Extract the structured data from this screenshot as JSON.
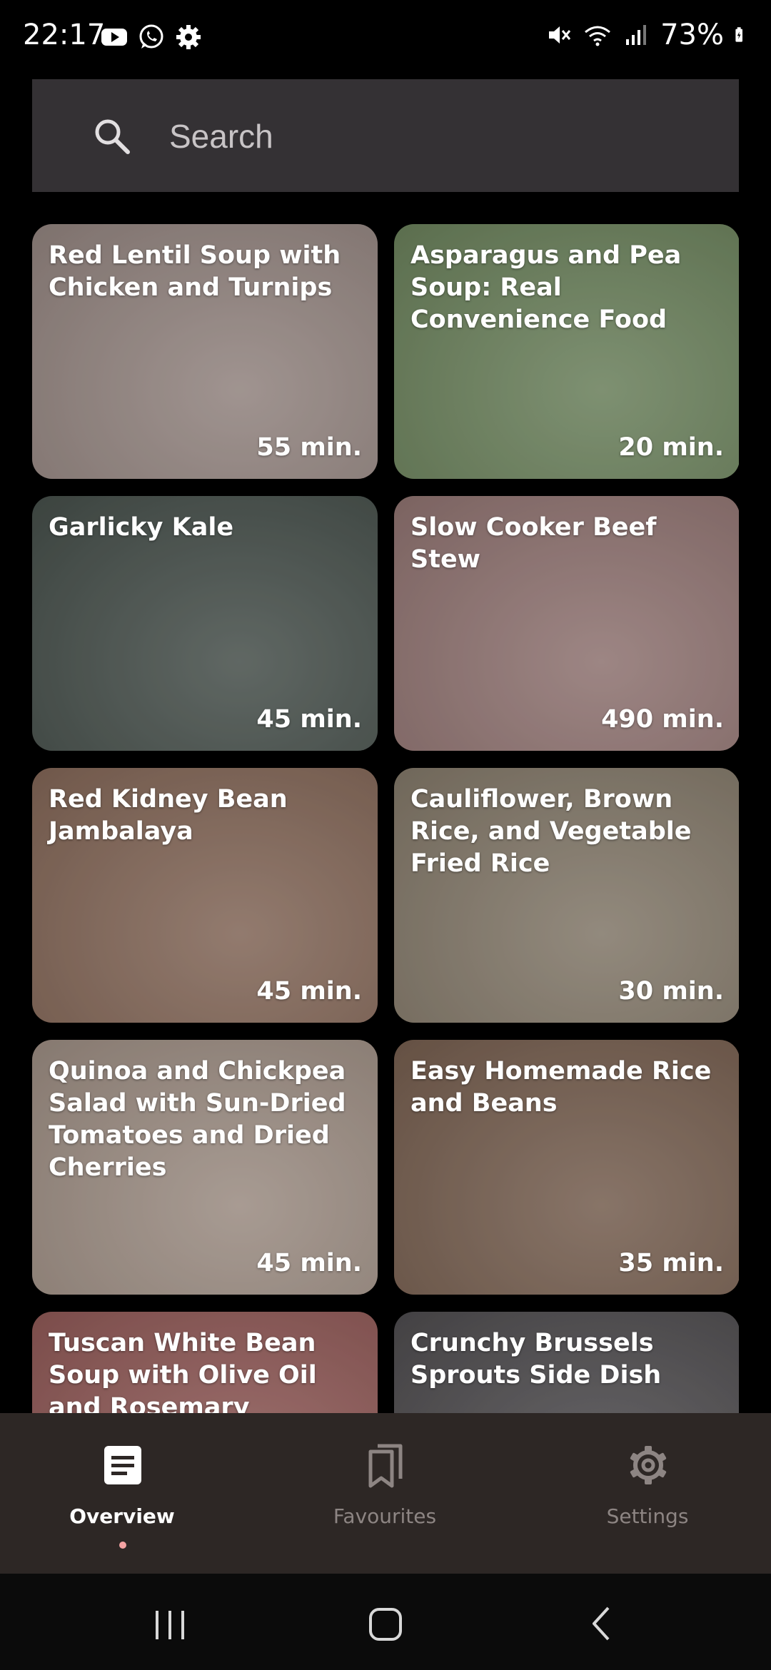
{
  "status_bar": {
    "time": "22:17",
    "battery": "73%",
    "left_icons": [
      "youtube-icon",
      "whatsapp-icon",
      "settings-icon"
    ],
    "right_icons": [
      "mute-icon",
      "wifi-icon",
      "signal-icon",
      "battery-icon"
    ]
  },
  "search": {
    "placeholder": "Search",
    "value": ""
  },
  "recipes": [
    {
      "title": "Red Lentil Soup with Chicken and Turnips",
      "time": "55 min.",
      "bg": "#8e7f6c"
    },
    {
      "title": "Asparagus and Pea Soup: Real Convenience Food",
      "time": "20 min.",
      "bg": "#5c7a3f"
    },
    {
      "title": "Garlicky Kale",
      "time": "45 min.",
      "bg": "#2f3d2a"
    },
    {
      "title": "Slow Cooker Beef Stew",
      "time": "490 min.",
      "bg": "#8a6a5a"
    },
    {
      "title": "Red Kidney Bean Jambalaya",
      "time": "45 min.",
      "bg": "#7a5a3a"
    },
    {
      "title": "Cauliflower, Brown Rice, and Vegetable Fried Rice",
      "time": "30 min.",
      "bg": "#7a7050"
    },
    {
      "title": "Quinoa and Chickpea Salad with Sun-Dried Tomatoes and Dried Cherries",
      "time": "45 min.",
      "bg": "#9a8a70"
    },
    {
      "title": "Easy Homemade Rice and Beans",
      "time": "35 min.",
      "bg": "#6a5030"
    },
    {
      "title": "Tuscan White Bean Soup with Olive Oil and Rosemary",
      "time": "",
      "bg": "#8a4a3a"
    },
    {
      "title": "Crunchy Brussels Sprouts Side Dish",
      "time": "",
      "bg": "#3a3a30"
    }
  ],
  "bottom_nav": {
    "items": [
      {
        "label": "Overview",
        "icon": "document-icon",
        "active": true
      },
      {
        "label": "Favourites",
        "icon": "bookmarks-icon",
        "active": false
      },
      {
        "label": "Settings",
        "icon": "gear-icon",
        "active": false
      }
    ]
  },
  "colors": {
    "active_label": "#ffffff",
    "inactive_label": "#8d8583",
    "active_dot": "#f4a3a3",
    "nav_background": "#2d2725",
    "search_background": "#343134"
  }
}
